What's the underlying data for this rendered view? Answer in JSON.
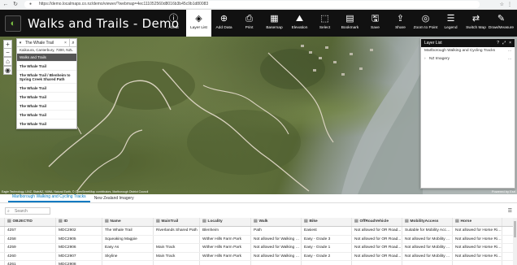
{
  "browser": {
    "url": "https://demo.localmaps.co.nz/demo/viewer/?webmap=4ec111052560d8016b3b45c9b1d80083",
    "back": "←",
    "reload": "↻"
  },
  "app": {
    "title": "Walks and Trails - Demo",
    "logo_glyph": "◐"
  },
  "toolbar": [
    {
      "label": "About",
      "icon": "info-icon",
      "glyph": "ⓘ",
      "active": false
    },
    {
      "label": "Layer List",
      "icon": "layers-icon",
      "glyph": "◈",
      "active": true
    },
    {
      "label": "Add Data",
      "icon": "add-data-icon",
      "glyph": "⊕",
      "active": false
    },
    {
      "label": "Print",
      "icon": "print-icon",
      "glyph": "⎙",
      "active": false
    },
    {
      "label": "Basemap",
      "icon": "basemap-icon",
      "glyph": "▦",
      "active": false
    },
    {
      "label": "Elevation",
      "icon": "elevation-icon",
      "glyph": "⛰",
      "active": false
    },
    {
      "label": "Select",
      "icon": "select-icon",
      "glyph": "⬚",
      "active": false
    },
    {
      "label": "Bookmark",
      "icon": "bookmark-icon",
      "glyph": "▤",
      "active": false
    },
    {
      "label": "Save",
      "icon": "save-icon",
      "glyph": "🖫",
      "active": false
    },
    {
      "label": "Share",
      "icon": "share-icon",
      "glyph": "⇪",
      "active": false
    },
    {
      "label": "Zoom to Point",
      "icon": "zoom-to-point-icon",
      "glyph": "◎",
      "active": false
    },
    {
      "label": "Legend",
      "icon": "legend-icon",
      "glyph": "☰",
      "active": false
    },
    {
      "label": "Switch Map",
      "icon": "switch-map-icon",
      "glyph": "⇄",
      "active": false
    },
    {
      "label": "Draw/Measure",
      "icon": "draw-measure-icon",
      "glyph": "✎",
      "active": false
    }
  ],
  "search": {
    "value": "The Whale Trail",
    "clear": "×",
    "go": "⌕",
    "address_suggestion": "Kaikoura, Canterbury, 7300, NZL",
    "group_label": "Walks and Trails",
    "results": [
      "The Whale Trail",
      "The Whale Trail / Blenheim to Spring Creek Shared Path",
      "The Whale Trail",
      "The Whale Trail",
      "The Whale Trail",
      "The Whale Trail",
      "The Whale Trail"
    ]
  },
  "map_controls": {
    "zoom_in": "+",
    "zoom_out": "−",
    "home": "⌂",
    "locate": "◉",
    "attribution": "Eagle Technology, LINZ, StatsNZ, NIWA, Natural Earth, © OpenStreetMap contributors, Marlborough District Council",
    "esri": "Powered by Esri",
    "coords": "173.879481 -41.459319"
  },
  "layer_list": {
    "title": "Layer List",
    "icons": [
      "?",
      "⤢",
      "×"
    ],
    "items": [
      {
        "name": "Marlborough Walking and Cycling Tracks",
        "menu": "..."
      },
      {
        "name": "NZ Imagery",
        "menu": "..."
      }
    ]
  },
  "attribute_table": {
    "tabs": [
      "Marlborough Walking and Cycling Tracks",
      "New Zealand Imagery"
    ],
    "active_tab": 0,
    "search_placeholder": "Search",
    "columns": [
      "OBJECTID",
      "ID",
      "Name",
      "MainTrail",
      "Locality",
      "Walk",
      "Bike",
      "OffRoadVehicle",
      "MobilityAccess",
      "Horse"
    ],
    "rows": [
      [
        "4257",
        "MDC2902",
        "The Whale Trail",
        "Riverlands Shared Path",
        "Blenheim",
        "Path",
        "Easiest",
        "Not allowed for OR Road...",
        "Suitable for Mobility Access",
        "Not allowed for Horse Ridi..."
      ],
      [
        "4258",
        "MDC2905",
        "Squeaking Magpie",
        "",
        "Wither Hills Farm Park",
        "Not allowed for Walking o...",
        "Easy - Grade 3",
        "Not allowed for OR Road...",
        "Not allowed for Mobility Acc...",
        "Not allowed for Horse Ridi..."
      ],
      [
        "4259",
        "MDC2906",
        "Easy As",
        "Main Track",
        "Wither Hills Farm Park",
        "Not allowed for Walking o...",
        "Easy - Grade 1",
        "Not allowed for OR Road...",
        "Not allowed for Mobility Acc...",
        "Not allowed for Horse Ridi..."
      ],
      [
        "4260",
        "MDC2907",
        "Skyline",
        "Main Track",
        "Wither Hills Farm Park",
        "Not allowed for Walking o...",
        "Easy - Grade 2",
        "Not allowed for OR Road...",
        "Not allowed for Mobility Acc...",
        "Not allowed for Horse Ridi..."
      ],
      [
        "4261",
        "MDC2908",
        "",
        "",
        "",
        "",
        "",
        "",
        "",
        ""
      ]
    ]
  }
}
